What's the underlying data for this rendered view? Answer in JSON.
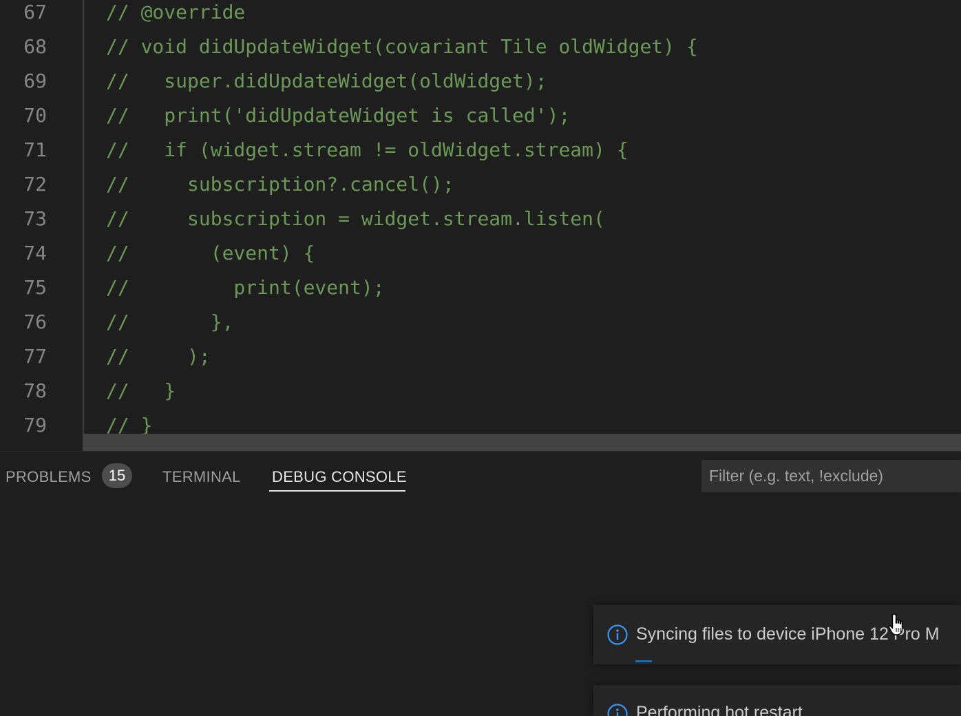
{
  "editor": {
    "lines": [
      {
        "number": "67",
        "code": "// @override"
      },
      {
        "number": "68",
        "code": "// void didUpdateWidget(covariant Tile oldWidget) {"
      },
      {
        "number": "69",
        "code": "//   super.didUpdateWidget(oldWidget);"
      },
      {
        "number": "70",
        "code": "//   print('didUpdateWidget is called');"
      },
      {
        "number": "71",
        "code": "//   if (widget.stream != oldWidget.stream) {"
      },
      {
        "number": "72",
        "code": "//     subscription?.cancel();"
      },
      {
        "number": "73",
        "code": "//     subscription = widget.stream.listen("
      },
      {
        "number": "74",
        "code": "//       (event) {"
      },
      {
        "number": "75",
        "code": "//         print(event);"
      },
      {
        "number": "76",
        "code": "//       },"
      },
      {
        "number": "77",
        "code": "//     );"
      },
      {
        "number": "78",
        "code": "//   }"
      },
      {
        "number": "79",
        "code": "// }"
      }
    ],
    "comment_color": "#6a9955",
    "line_number_color": "#858585"
  },
  "panel": {
    "tabs": [
      {
        "label": "PROBLEMS",
        "badge": "15",
        "active": false
      },
      {
        "label": "TERMINAL",
        "active": false
      },
      {
        "label": "DEBUG CONSOLE",
        "active": true
      }
    ],
    "filter_placeholder": "Filter (e.g. text, !exclude)"
  },
  "notifications": [
    {
      "icon": "info-icon",
      "text": "Syncing files to device iPhone 12 Pro M",
      "progress": "indeterminate"
    },
    {
      "icon": "info-icon",
      "text": "Performing hot restart..."
    }
  ],
  "colors": {
    "background": "#1e1e1e",
    "accent": "#0e70c0",
    "info_icon": "#3794ff"
  }
}
